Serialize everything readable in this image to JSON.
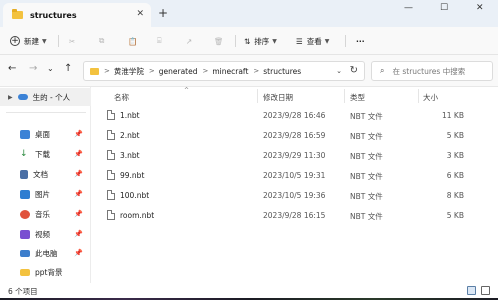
{
  "window": {
    "tab_title": "structures",
    "new_tab": "+",
    "minimize": "—",
    "maximize": "☐",
    "close": "✕"
  },
  "toolbar": {
    "new_label": "新建",
    "cut": "✂",
    "copy": "⧉",
    "paste": "📋",
    "rename": "⌸",
    "share": "↗",
    "delete": "🗑",
    "sort_label": "排序",
    "view_label": "查看",
    "more": "···"
  },
  "nav": {
    "back": "←",
    "forward": "→",
    "recent": "⌄",
    "up": "↑"
  },
  "address": {
    "path": [
      "黄淮学院",
      "generated",
      "minecraft",
      "structures"
    ],
    "separator": ">"
  },
  "search": {
    "placeholder": "在 structures 中搜索"
  },
  "sidebar": {
    "top_item": "生的 - 个人",
    "items": [
      {
        "label": "桌面",
        "icon": "desktop-icon",
        "color": "#3b82d6"
      },
      {
        "label": "下载",
        "icon": "download-icon",
        "color": "#2b8a3e"
      },
      {
        "label": "文档",
        "icon": "document-icon",
        "color": "#4a6fa5"
      },
      {
        "label": "图片",
        "icon": "pictures-icon",
        "color": "#2e7dd1"
      },
      {
        "label": "音乐",
        "icon": "music-icon",
        "color": "#e0533d"
      },
      {
        "label": "视频",
        "icon": "video-icon",
        "color": "#7a4fd1"
      },
      {
        "label": "此电脑",
        "icon": "computer-icon",
        "color": "#3d7ecc"
      },
      {
        "label": "ppt背景",
        "icon": "folder-icon",
        "color": "#f3c23f"
      }
    ]
  },
  "columns": {
    "name": "名称",
    "date": "修改日期",
    "type": "类型",
    "size": "大小"
  },
  "files": [
    {
      "name": "1.nbt",
      "date": "2023/9/28 16:46",
      "type": "NBT 文件",
      "size": "11 KB"
    },
    {
      "name": "2.nbt",
      "date": "2023/9/28 16:59",
      "type": "NBT 文件",
      "size": "5 KB"
    },
    {
      "name": "3.nbt",
      "date": "2023/9/29 11:30",
      "type": "NBT 文件",
      "size": "3 KB"
    },
    {
      "name": "99.nbt",
      "date": "2023/10/5 19:31",
      "type": "NBT 文件",
      "size": "6 KB"
    },
    {
      "name": "100.nbt",
      "date": "2023/10/5 19:36",
      "type": "NBT 文件",
      "size": "8 KB"
    },
    {
      "name": "room.nbt",
      "date": "2023/9/28 16:15",
      "type": "NBT 文件",
      "size": "5 KB"
    }
  ],
  "status": {
    "item_count": "6 个项目"
  }
}
